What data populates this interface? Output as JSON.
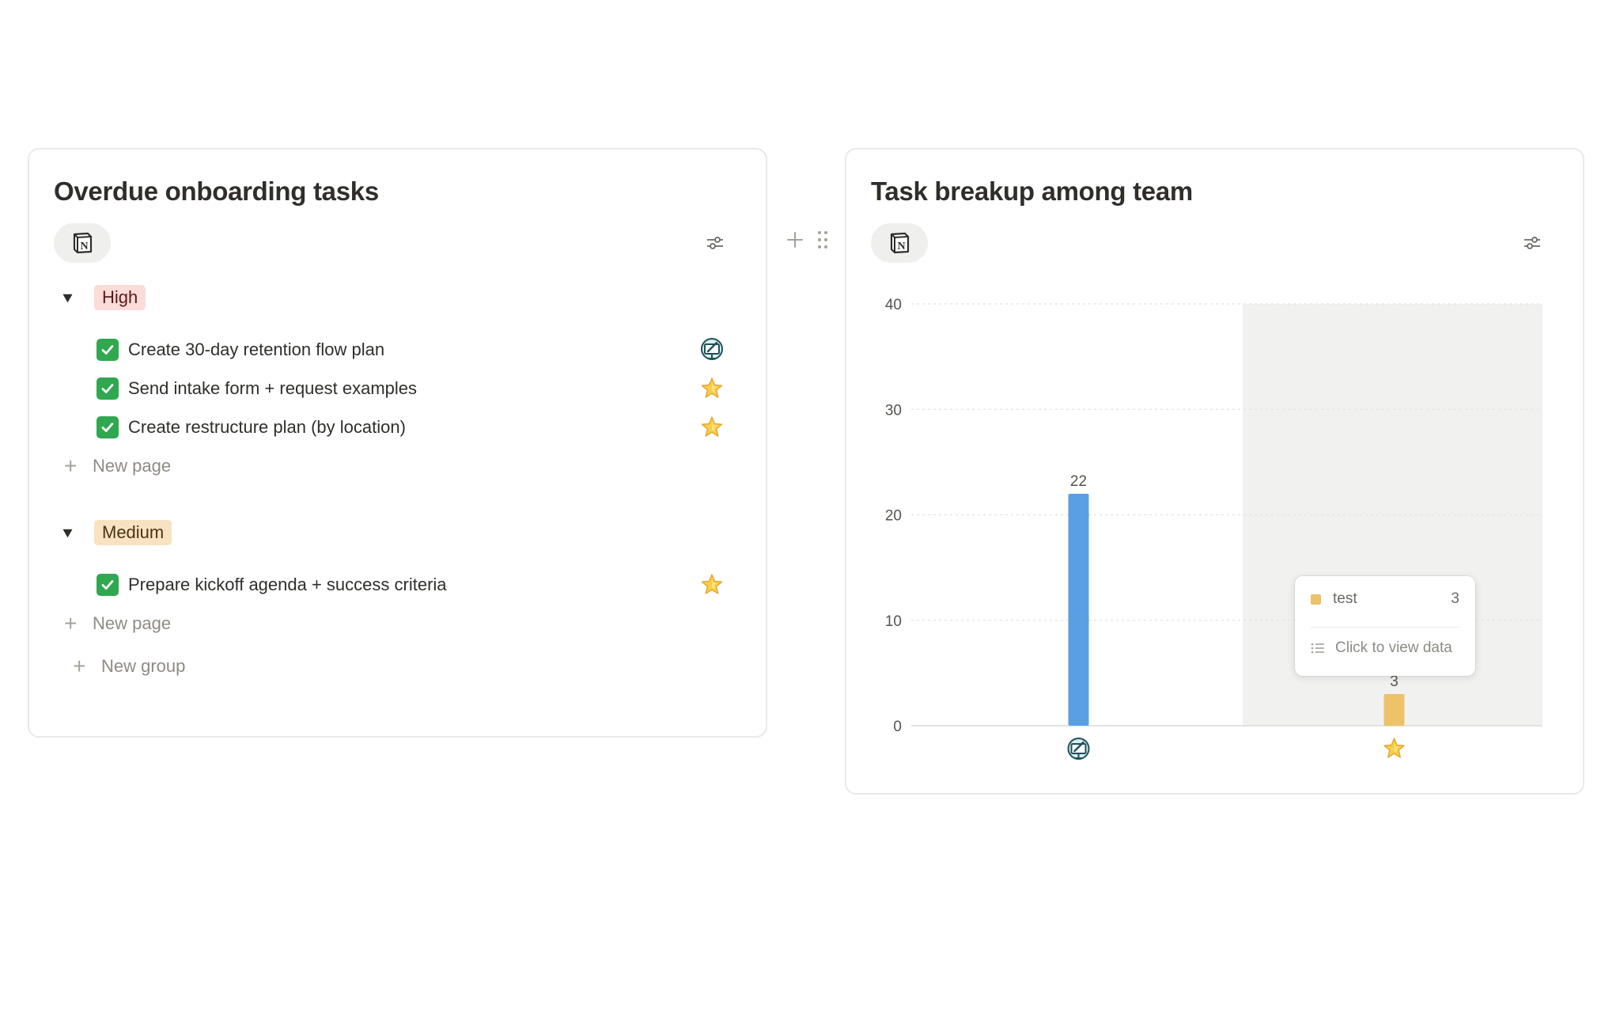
{
  "left_card": {
    "title": "Overdue onboarding tasks",
    "groups": [
      {
        "tag": "High",
        "tag_bg": "#fbdcd9",
        "tag_color": "#5d1715",
        "tasks": [
          {
            "label": "Create 30-day retention flow plan",
            "icon": "computer-icon"
          },
          {
            "label": "Send intake form + request examples",
            "icon": "star-icon"
          },
          {
            "label": "Create restructure plan (by location)",
            "icon": "star-icon"
          }
        ],
        "new_page_label": "New page"
      },
      {
        "tag": "Medium",
        "tag_bg": "#f7e3c2",
        "tag_color": "#4a3311",
        "tasks": [
          {
            "label": "Prepare kickoff agenda + success criteria",
            "icon": "star-icon"
          }
        ],
        "new_page_label": "New page"
      }
    ],
    "new_group_label": "New group"
  },
  "right_card": {
    "title": "Task breakup among team",
    "tooltip": {
      "series_name": "test",
      "value": "3",
      "action_label": "Click to view data"
    }
  },
  "chart_data": {
    "type": "bar",
    "categories": [
      "computer-icon",
      "star-icon"
    ],
    "values": [
      22,
      3
    ],
    "colors": [
      "#5b9fe3",
      "#edc268"
    ],
    "data_labels": [
      "22",
      "3"
    ],
    "yticks": [
      "0",
      "10",
      "20",
      "30",
      "40"
    ],
    "ylim": [
      0,
      40
    ],
    "grid": true,
    "highlighted_category": 1
  }
}
